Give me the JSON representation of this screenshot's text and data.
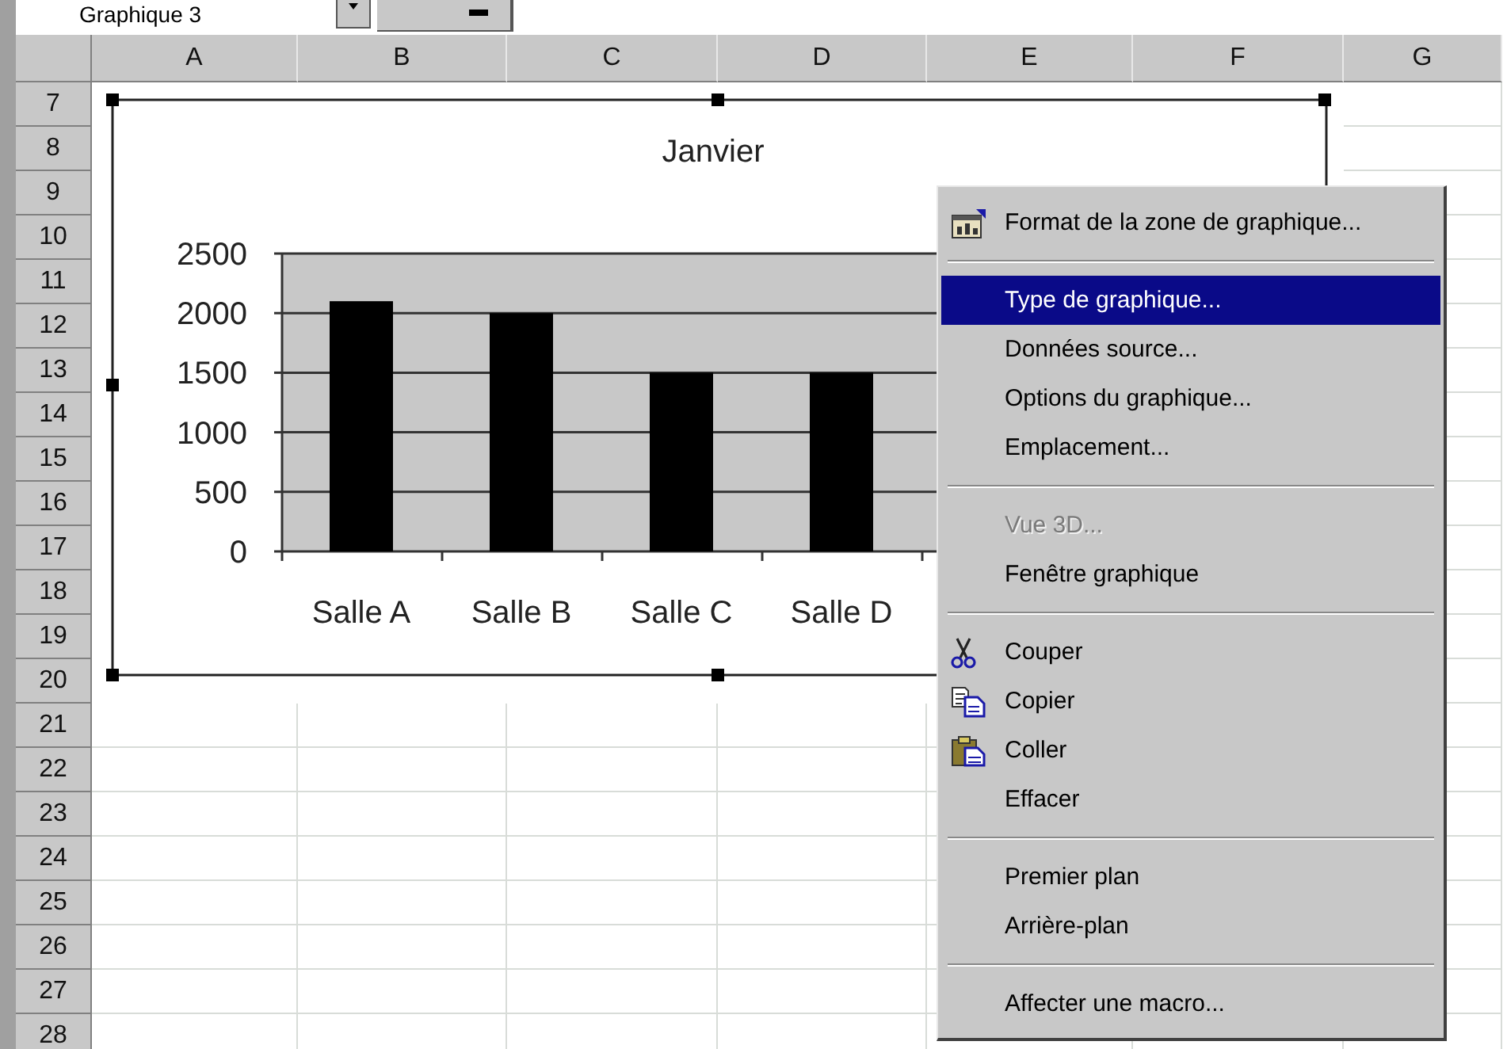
{
  "name_box": {
    "value": "Graphique 3"
  },
  "sheet": {
    "columns": [
      "A",
      "B",
      "C",
      "D",
      "E",
      "F",
      "G"
    ],
    "rows": [
      "7",
      "8",
      "9",
      "10",
      "11",
      "12",
      "13",
      "14",
      "15",
      "16",
      "17",
      "18",
      "19",
      "20",
      "21",
      "22",
      "23",
      "24",
      "25",
      "26",
      "27",
      "28"
    ]
  },
  "chart": {
    "selected": true,
    "chart_data": {
      "type": "bar",
      "title": "Janvier",
      "categories": [
        "Salle A",
        "Salle B",
        "Salle C",
        "Salle D"
      ],
      "values": [
        2100,
        2000,
        1500,
        1500
      ],
      "ylim": [
        0,
        2500
      ],
      "yticks": [
        0,
        500,
        1000,
        1500,
        2000,
        2500
      ],
      "grid": true
    }
  },
  "context_menu": {
    "items": [
      {
        "kind": "item",
        "label": "Format de la zone de graphique...",
        "selected": false,
        "disabled": false
      },
      {
        "kind": "separator"
      },
      {
        "kind": "item",
        "label": "Type de graphique...",
        "selected": true,
        "disabled": false
      },
      {
        "kind": "item",
        "label": "Données source...",
        "selected": false,
        "disabled": false
      },
      {
        "kind": "item",
        "label": "Options du graphique...",
        "selected": false,
        "disabled": false
      },
      {
        "kind": "item",
        "label": "Emplacement...",
        "selected": false,
        "disabled": false
      },
      {
        "kind": "separator"
      },
      {
        "kind": "item",
        "label": "Vue 3D...",
        "selected": false,
        "disabled": true
      },
      {
        "kind": "item",
        "label": "Fenêtre graphique",
        "selected": false,
        "disabled": false
      },
      {
        "kind": "separator"
      },
      {
        "kind": "item",
        "label": "Couper",
        "selected": false,
        "disabled": false
      },
      {
        "kind": "item",
        "label": "Copier",
        "selected": false,
        "disabled": false
      },
      {
        "kind": "item",
        "label": "Coller",
        "selected": false,
        "disabled": false
      },
      {
        "kind": "item",
        "label": "Effacer",
        "selected": false,
        "disabled": false
      },
      {
        "kind": "separator"
      },
      {
        "kind": "item",
        "label": "Premier plan",
        "selected": false,
        "disabled": false
      },
      {
        "kind": "item",
        "label": "Arrière-plan",
        "selected": false,
        "disabled": false
      },
      {
        "kind": "separator"
      },
      {
        "kind": "item",
        "label": "Affecter une macro...",
        "selected": false,
        "disabled": false
      }
    ]
  }
}
